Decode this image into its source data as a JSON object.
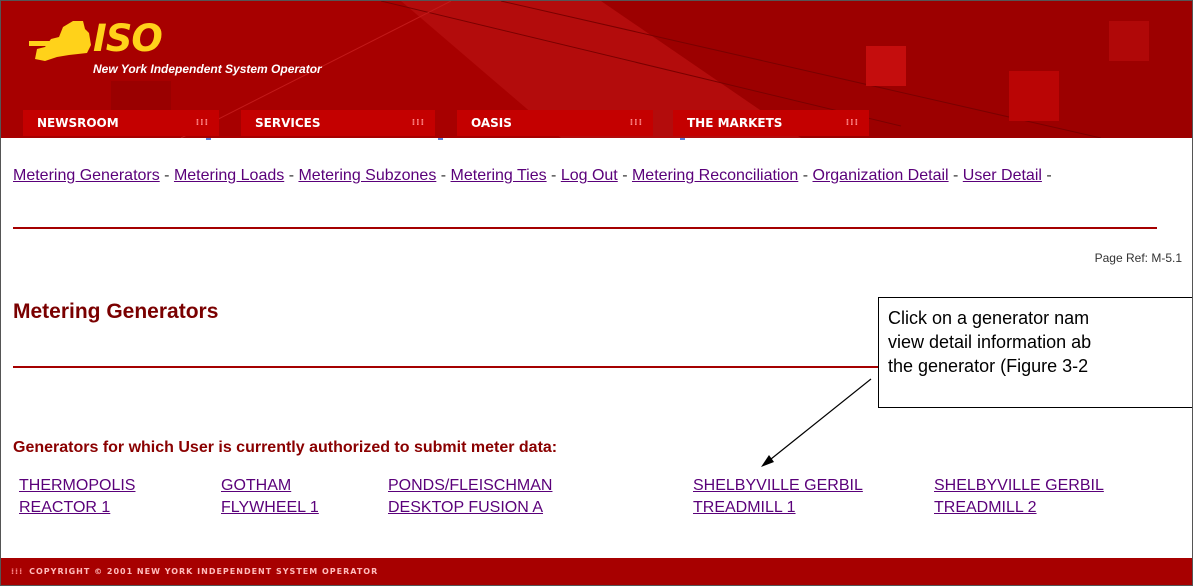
{
  "header": {
    "logo_text": "ISO",
    "tagline": "New York Independent System Operator",
    "tabs": [
      {
        "label": "NEWSROOM"
      },
      {
        "label": "SERVICES"
      },
      {
        "label": "OASIS"
      },
      {
        "label": "THE MARKETS"
      }
    ]
  },
  "nav": {
    "links": [
      {
        "label": "Metering Generators"
      },
      {
        "label": "Metering Loads"
      },
      {
        "label": "Metering Subzones"
      },
      {
        "label": "Metering Ties"
      },
      {
        "label": "Log Out"
      },
      {
        "label": "Metering Reconciliation"
      },
      {
        "label": "Organization Detail"
      },
      {
        "label": "User Detail"
      }
    ],
    "separator": " - "
  },
  "page_ref": "Page Ref: M-5.1",
  "page_title": "Metering Generators",
  "subheading": "Generators for which User is currently authorized to submit meter data:",
  "generators": [
    {
      "line1": "THERMOPOLIS",
      "line2": "REACTOR 1"
    },
    {
      "line1": "GOTHAM",
      "line2": "FLYWHEEL 1"
    },
    {
      "line1": "PONDS/FLEISCHMAN",
      "line2": "DESKTOP FUSION A"
    },
    {
      "line1": "SHELBYVILLE GERBIL",
      "line2": "TREADMILL 1"
    },
    {
      "line1": "SHELBYVILLE GERBIL",
      "line2": "TREADMILL 2"
    }
  ],
  "callout": {
    "line1": "Click on a generator nam",
    "line2": "view detail information ab",
    "line3": "the generator (Figure 3-2"
  },
  "footer": {
    "text": "COPYRIGHT © 2001 NEW YORK INDEPENDENT SYSTEM OPERATOR"
  },
  "colors": {
    "brand_red": "#a70000",
    "tab_red": "#c40000",
    "logo_yellow": "#ffd21a",
    "link_purple": "#5a007a"
  },
  "icons": [
    "new-york-state-logo-icon",
    "tab-dots-icon",
    "footer-dots-icon"
  ]
}
